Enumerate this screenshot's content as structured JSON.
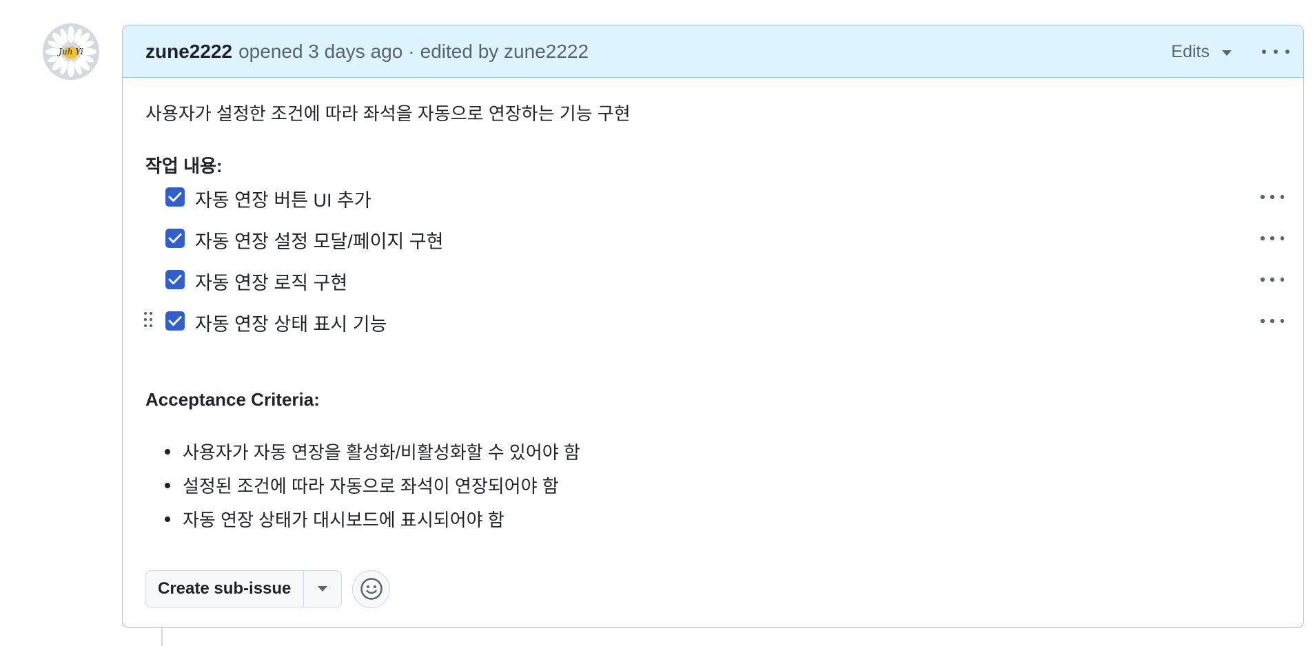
{
  "comment": {
    "author": "zune2222",
    "meta_opened": "opened 3 days ago",
    "meta_separator": "·",
    "meta_edited": "edited by zune2222",
    "edits_label": "Edits",
    "avatar_text": "Juh Yi"
  },
  "body": {
    "intro": "사용자가 설정한 조건에 따라 좌석을 자동으로 연장하는 기능 구현",
    "tasks_heading": "작업 내용:",
    "tasks": [
      {
        "label": "자동 연장 버튼 UI 추가",
        "checked": true
      },
      {
        "label": "자동 연장 설정 모달/페이지 구현",
        "checked": true
      },
      {
        "label": "자동 연장 로직 구현",
        "checked": true
      },
      {
        "label": "자동 연장 상태 표시 기능",
        "checked": true
      }
    ],
    "criteria_heading": "Acceptance Criteria:",
    "criteria": [
      "사용자가 자동 연장을 활성화/비활성화할 수 있어야 함",
      "설정된 조건에 따라 자동으로 좌석이 연장되어야 함",
      "자동 연장 상태가 대시보드에 표시되어야 함"
    ]
  },
  "actions": {
    "create_sub_issue_label": "Create sub-issue"
  },
  "icons": {
    "kebab": "kebab-horizontal-icon",
    "caret": "triangle-down-icon",
    "checkbox": "check-icon",
    "drag": "grabber-icon",
    "emoji": "smiley-icon"
  },
  "colors": {
    "header_bg": "#ddf4ff",
    "border": "#9ec5f0",
    "checkbox": "#2f5fd0",
    "muted_text": "#59636e"
  }
}
